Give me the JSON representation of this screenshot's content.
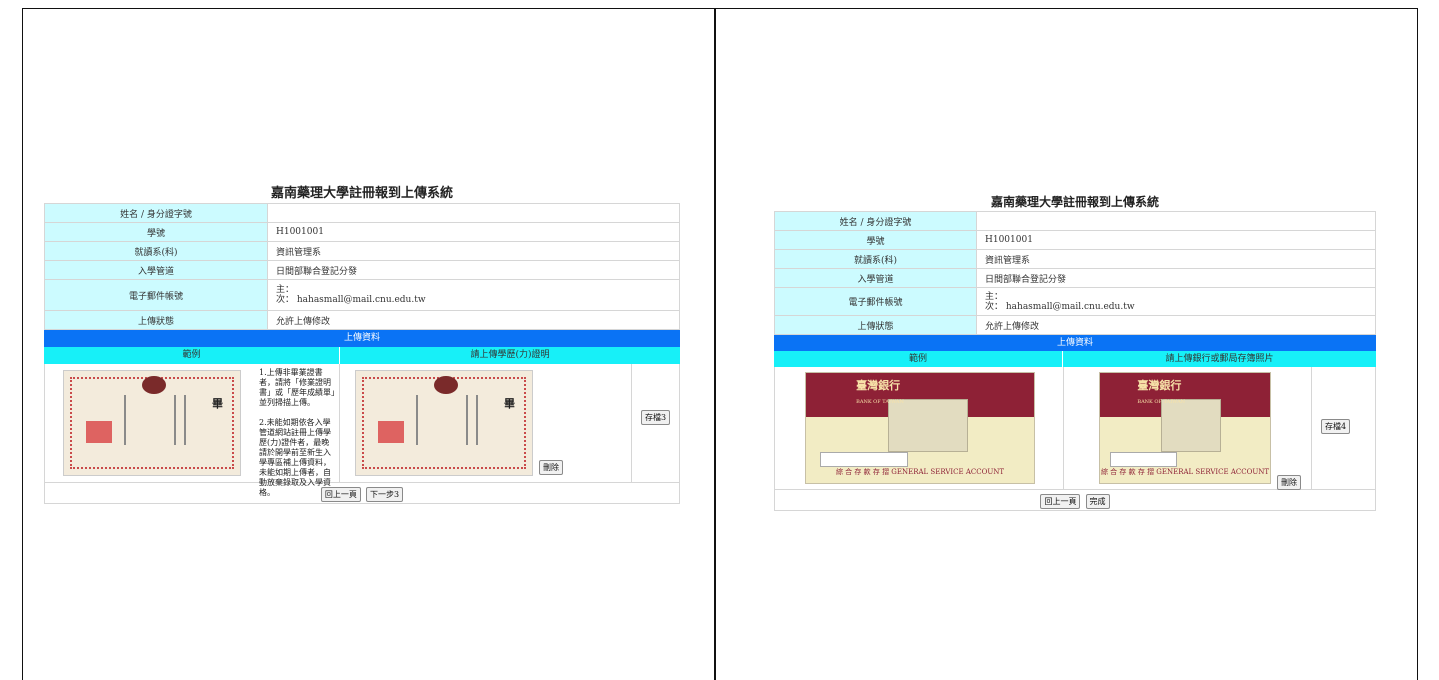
{
  "panels": [
    {
      "title": "嘉南藥理大學註冊報到上傳系統",
      "rows": [
        {
          "label": "姓名 / 身分證字號",
          "value": ""
        },
        {
          "label": "學號",
          "value": "H1001001"
        },
        {
          "label": "就讀系(科)",
          "value": "資訊管理系"
        },
        {
          "label": "入學管道",
          "value": "日間部聯合登記分發"
        },
        {
          "label": "電子郵件帳號",
          "value": "主：",
          "value2": "次： hahasmall@mail.cnu.edu.tw"
        },
        {
          "label": "上傳狀態",
          "value": "允許上傳修改"
        }
      ],
      "section_header": "上傳資料",
      "col_example": "範例",
      "col_upload": "請上傳學歷(力)證明",
      "note": "1.上傳非畢業證書者，請將「修業證明書」或「歷年成績單」並列掃描上傳。\n\n2.未能如期依各入學管道網站註冊上傳學歷(力)證件者，最晚請於開學前至新生入學專區補上傳資料，未能如期上傳者，自動放棄錄取及入學資格。",
      "save_button": "存檔3",
      "delete_button": "刪除",
      "back_button": "回上一頁",
      "next_button": "下一步3"
    },
    {
      "title": "嘉南藥理大學註冊報到上傳系統",
      "rows": [
        {
          "label": "姓名 / 身分證字號",
          "value": ""
        },
        {
          "label": "學號",
          "value": "H1001001"
        },
        {
          "label": "就讀系(科)",
          "value": "資訊管理系"
        },
        {
          "label": "入學管道",
          "value": "日間部聯合登記分發"
        },
        {
          "label": "電子郵件帳號",
          "value": "主：",
          "value2": "次： hahasmall@mail.cnu.edu.tw"
        },
        {
          "label": "上傳狀態",
          "value": "允許上傳修改"
        }
      ],
      "section_header": "上傳資料",
      "col_example": "範例",
      "col_upload": "請上傳銀行或郵局存簿照片",
      "bank_brand": "臺灣銀行",
      "bank_brand_en": "BANK OF TAIWAN",
      "bank_footer": "綜 合 存 款 存 摺    GENERAL SERVICE ACCOUNT",
      "save_button": "存檔4",
      "delete_button": "刪除",
      "back_button": "回上一頁",
      "done_button": "完成"
    }
  ]
}
